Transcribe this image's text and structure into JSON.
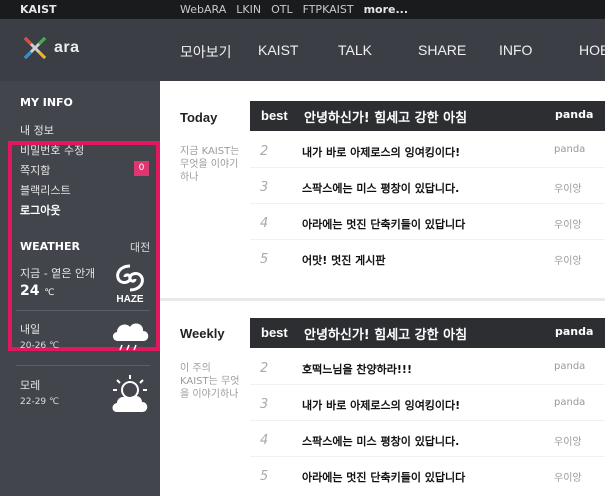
{
  "topbar": {
    "brand": "KAIST",
    "links": [
      "WebARA",
      "LKIN",
      "OTL",
      "FTPKAIST"
    ],
    "more": "more..."
  },
  "header": {
    "logo_text": "ara",
    "nav": [
      "모아보기",
      "KAIST",
      "TALK",
      "SHARE",
      "INFO",
      "HOB"
    ]
  },
  "sidebar": {
    "my_info_title": "MY INFO",
    "items": [
      "내 정보",
      "비밀번호 수정",
      "쪽지함",
      "블랙리스트",
      "로그아웃"
    ],
    "message_count": "0",
    "weather": {
      "title": "WEATHER",
      "city": "대전",
      "now_label": "지금 - 옅은 안개",
      "now_temp": "24",
      "temp_unit": "℃",
      "now_icon_label": "HAZE",
      "tomorrow_label": "내일",
      "tomorrow_temp": "20-26 ℃",
      "dayafter_label": "모레",
      "dayafter_temp": "22-29 ℃"
    }
  },
  "today": {
    "label": "Today",
    "desc": "지금 KAIST는 무엇을 이야기하나",
    "best": {
      "tag": "best",
      "title": "안녕하신가! 힘세고 강한 아침",
      "author": "panda"
    },
    "rows": [
      {
        "num": "2",
        "title": "내가 바로 아제로스의 잉여킹이다!",
        "author": "panda"
      },
      {
        "num": "3",
        "title": "스팍스에는 미스 평창이 있답니다.",
        "author": "우이앙"
      },
      {
        "num": "4",
        "title": "아라에는 멋진 단축키들이 있답니다",
        "author": "우이앙"
      },
      {
        "num": "5",
        "title": "어맛! 멋진 게시판",
        "author": "우이앙"
      }
    ]
  },
  "weekly": {
    "label": "Weekly",
    "desc": "이 주의 KAIST는 무엇을 이야기하나",
    "best": {
      "tag": "best",
      "title": "안녕하신가! 힘세고 강한 아침",
      "author": "panda"
    },
    "rows": [
      {
        "num": "2",
        "title": "호떡느님을 찬양하라!!!",
        "author": "panda"
      },
      {
        "num": "3",
        "title": "내가 바로 아제로스의 잉여킹이다!",
        "author": "panda"
      },
      {
        "num": "4",
        "title": "스팍스에는 미스 평창이 있답니다.",
        "author": "우이앙"
      },
      {
        "num": "5",
        "title": "아라에는 멋진 단축키들이 있답니다",
        "author": "우이앙"
      }
    ]
  },
  "colors": {
    "accent": "#e2185f",
    "header_bg": "#3b3f45",
    "best_bar_bg": "#2c2e32"
  }
}
